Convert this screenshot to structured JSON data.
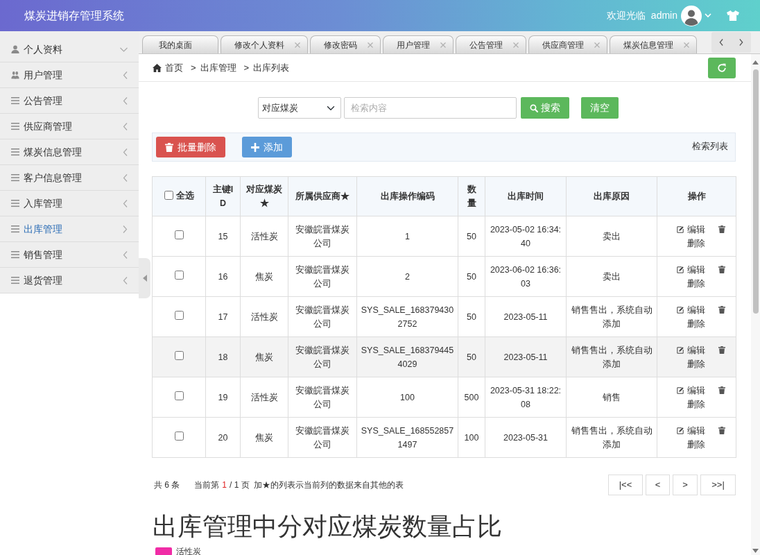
{
  "header": {
    "title": "煤炭进销存管理系统",
    "greeting": "欢迎光临",
    "username": "admin"
  },
  "sidebar": {
    "items": [
      {
        "kind": "profile",
        "label": "个人资料",
        "selected": false
      },
      {
        "kind": "users",
        "label": "用户管理",
        "selected": false
      },
      {
        "kind": "list",
        "label": "公告管理",
        "selected": false
      },
      {
        "kind": "list",
        "label": "供应商管理",
        "selected": false
      },
      {
        "kind": "list",
        "label": "煤炭信息管理",
        "selected": false
      },
      {
        "kind": "list",
        "label": "客户信息管理",
        "selected": false
      },
      {
        "kind": "list",
        "label": "入库管理",
        "selected": false
      },
      {
        "kind": "list",
        "label": "出库管理",
        "selected": true
      },
      {
        "kind": "list",
        "label": "销售管理",
        "selected": false
      },
      {
        "kind": "list",
        "label": "退货管理",
        "selected": false
      }
    ]
  },
  "tabs": [
    {
      "label": "我的桌面",
      "closable": false,
      "selected": false
    },
    {
      "label": "修改个人资料",
      "closable": true,
      "selected": false
    },
    {
      "label": "修改密码",
      "closable": true,
      "selected": false
    },
    {
      "label": "用户管理",
      "closable": true,
      "selected": false
    },
    {
      "label": "公告管理",
      "closable": true,
      "selected": false
    },
    {
      "label": "供应商管理",
      "closable": true,
      "selected": false
    },
    {
      "label": "煤炭信息管理",
      "closable": true,
      "selected": false
    }
  ],
  "breadcrumb": [
    {
      "kind": "home",
      "label": "首页"
    },
    {
      "kind": "separator",
      "label": ">"
    },
    {
      "kind": "link",
      "label": "出库管理"
    },
    {
      "kind": "separator",
      "label": ">"
    },
    {
      "kind": "current",
      "label": "出库列表"
    }
  ],
  "search": {
    "field": "对应煤炭",
    "placeholder": "检索内容",
    "buttons": [
      {
        "kind": "search",
        "label": "搜索"
      },
      {
        "kind": "clear",
        "label": "清空"
      }
    ]
  },
  "toolbar": {
    "buttons": [
      {
        "kind": "delete",
        "label": "批量删除"
      },
      {
        "kind": "add",
        "label": "添加"
      }
    ],
    "caption": "检索列表"
  },
  "table": {
    "columns": [
      {
        "kind": "select",
        "label": "全选",
        "checked": false
      },
      {
        "kind": "text",
        "label": "主键ID"
      },
      {
        "kind": "text",
        "label": "对应煤炭★"
      },
      {
        "kind": "text",
        "label": "所属供应商★"
      },
      {
        "kind": "text",
        "label": "出库操作编码"
      },
      {
        "kind": "text",
        "label": "数量"
      },
      {
        "kind": "text",
        "label": "出库时间"
      },
      {
        "kind": "text",
        "label": "出库原因"
      },
      {
        "kind": "actions",
        "label": "操作"
      }
    ],
    "rows": [
      {
        "checked": false,
        "hovered": false,
        "cells": [
          "",
          "15",
          "活性炭",
          "安徽皖晋煤炭公司",
          "1",
          "50",
          "2023-05-02 16:34:40",
          "卖出"
        ],
        "actions": [
          {
            "kind": "edit",
            "label": "编辑"
          },
          {
            "kind": "delete",
            "label": "删除"
          }
        ]
      },
      {
        "checked": false,
        "hovered": false,
        "cells": [
          "",
          "16",
          "焦炭",
          "安徽皖晋煤炭公司",
          "2",
          "50",
          "2023-06-02 16:36:03",
          "卖出"
        ],
        "actions": [
          {
            "kind": "edit",
            "label": "编辑"
          },
          {
            "kind": "delete",
            "label": "删除"
          }
        ]
      },
      {
        "checked": false,
        "hovered": false,
        "cells": [
          "",
          "17",
          "活性炭",
          "安徽皖晋煤炭公司",
          "SYS_SALE_1683794302752",
          "50",
          "2023-05-11",
          "销售售出，系统自动添加"
        ],
        "actions": [
          {
            "kind": "edit",
            "label": "编辑"
          },
          {
            "kind": "delete",
            "label": "删除"
          }
        ]
      },
      {
        "checked": false,
        "hovered": true,
        "cells": [
          "",
          "18",
          "焦炭",
          "安徽皖晋煤炭公司",
          "SYS_SALE_1683794454029",
          "50",
          "2023-05-11",
          "销售售出，系统自动添加"
        ],
        "actions": [
          {
            "kind": "edit",
            "label": "编辑"
          },
          {
            "kind": "delete",
            "label": "删除"
          }
        ]
      },
      {
        "checked": false,
        "hovered": false,
        "cells": [
          "",
          "19",
          "活性炭",
          "安徽皖晋煤炭公司",
          "100",
          "500",
          "2023-05-31 18:22:08",
          "销售"
        ],
        "actions": [
          {
            "kind": "edit",
            "label": "编辑"
          },
          {
            "kind": "delete",
            "label": "删除"
          }
        ]
      },
      {
        "checked": false,
        "hovered": false,
        "cells": [
          "",
          "20",
          "焦炭",
          "安徽皖晋煤炭公司",
          "SYS_SALE_1685528571497",
          "100",
          "2023-05-31",
          "销售售出，系统自动添加"
        ],
        "actions": [
          {
            "kind": "edit",
            "label": "编辑"
          },
          {
            "kind": "delete",
            "label": "删除"
          }
        ]
      }
    ]
  },
  "pagination": {
    "total": "共 6 条",
    "page_label": "当前第",
    "page_current": "1",
    "page_total": "/ 1 页",
    "note": "加★的列表示当前列的数据来自其他的表",
    "buttons": [
      "|<<",
      "<",
      ">",
      ">>|"
    ]
  },
  "chart": {
    "title": "出库管理中分对应煤炭数量占比",
    "legend": [
      {
        "label": "活性炭",
        "color": "#f02ca6"
      }
    ]
  }
}
